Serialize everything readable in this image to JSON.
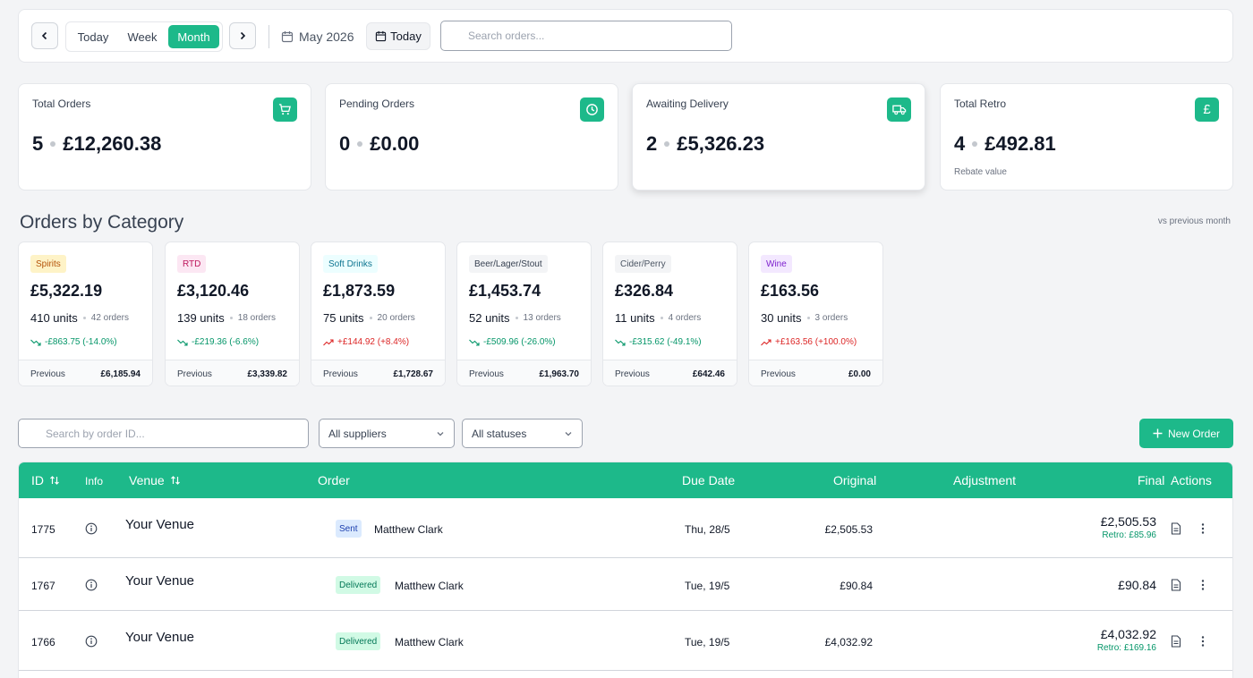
{
  "toolbar": {
    "range_tabs": [
      "Today",
      "Week",
      "Month"
    ],
    "active_tab": "Month",
    "month_label": "May 2026",
    "today_button": "Today",
    "search_placeholder": "Search orders..."
  },
  "stats": [
    {
      "title": "Total Orders",
      "count": "5",
      "amount": "£12,260.38",
      "icon": "cart-icon",
      "sub": ""
    },
    {
      "title": "Pending Orders",
      "count": "0",
      "amount": "£0.00",
      "icon": "clock-icon",
      "sub": ""
    },
    {
      "title": "Awaiting Delivery",
      "count": "2",
      "amount": "£5,326.23",
      "icon": "truck-icon",
      "sub": ""
    },
    {
      "title": "Total Retro",
      "count": "4",
      "amount": "£492.81",
      "icon": "pound-icon",
      "sub": "Rebate value"
    }
  ],
  "categories_section": {
    "title": "Orders by Category",
    "note": "vs previous month"
  },
  "categories": [
    {
      "name": "Spirits",
      "total": "£5,322.19",
      "units": "410 units",
      "orders": "42 orders",
      "change": "-£863.75 (-14.0%)",
      "trend": "down",
      "previous_label": "Previous",
      "previous": "£6,185.94",
      "badge_bg": "#fef3c7",
      "badge_fg": "#b45309"
    },
    {
      "name": "RTD",
      "total": "£3,120.46",
      "units": "139 units",
      "orders": "18 orders",
      "change": "-£219.36 (-6.6%)",
      "trend": "down",
      "previous_label": "Previous",
      "previous": "£3,339.82",
      "badge_bg": "#fce7f3",
      "badge_fg": "#be185d"
    },
    {
      "name": "Soft Drinks",
      "total": "£1,873.59",
      "units": "75 units",
      "orders": "20 orders",
      "change": "+£144.92 (+8.4%)",
      "trend": "up",
      "previous_label": "Previous",
      "previous": "£1,728.67",
      "badge_bg": "#ecfeff",
      "badge_fg": "#0e7490"
    },
    {
      "name": "Beer/Lager/Stout",
      "total": "£1,453.74",
      "units": "52 units",
      "orders": "13 orders",
      "change": "-£509.96 (-26.0%)",
      "trend": "down",
      "previous_label": "Previous",
      "previous": "£1,963.70",
      "badge_bg": "#f3f4f6",
      "badge_fg": "#374151"
    },
    {
      "name": "Cider/Perry",
      "total": "£326.84",
      "units": "11 units",
      "orders": "4 orders",
      "change": "-£315.62 (-49.1%)",
      "trend": "down",
      "previous_label": "Previous",
      "previous": "£642.46",
      "badge_bg": "#f3f4f6",
      "badge_fg": "#4b5563"
    },
    {
      "name": "Wine",
      "total": "£163.56",
      "units": "30 units",
      "orders": "3 orders",
      "change": "+£163.56 (+100.0%)",
      "trend": "up",
      "previous_label": "Previous",
      "previous": "£0.00",
      "badge_bg": "#f3e8ff",
      "badge_fg": "#7e22ce"
    }
  ],
  "filters": {
    "order_search_placeholder": "Search by order ID...",
    "supplier_select": "All suppliers",
    "status_select": "All statuses",
    "new_order_label": "New Order"
  },
  "table": {
    "headers": {
      "id": "ID",
      "info": "Info",
      "venue": "Venue",
      "order": "Order",
      "due_date": "Due Date",
      "original": "Original",
      "adjustment": "Adjustment",
      "final": "Final",
      "actions": "Actions"
    },
    "rows": [
      {
        "id": "1775",
        "venue": "Your Venue",
        "status": "Sent",
        "supplier": "Matthew Clark",
        "due": "Thu, 28/5",
        "original": "£2,505.53",
        "final": "£2,505.53",
        "retro": "Retro: £85.96"
      },
      {
        "id": "1767",
        "venue": "Your Venue",
        "status": "Delivered",
        "supplier": "Matthew Clark",
        "due": "Tue, 19/5",
        "original": "£90.84",
        "final": "£90.84",
        "retro": ""
      },
      {
        "id": "1766",
        "venue": "Your Venue",
        "status": "Delivered",
        "supplier": "Matthew Clark",
        "due": "Tue, 19/5",
        "original": "£4,032.92",
        "final": "£4,032.92",
        "retro": "Retro: £169.16"
      }
    ]
  },
  "colors": {
    "accent": "#1db98a",
    "trend_down": "#059669",
    "trend_up": "#dc2626"
  }
}
